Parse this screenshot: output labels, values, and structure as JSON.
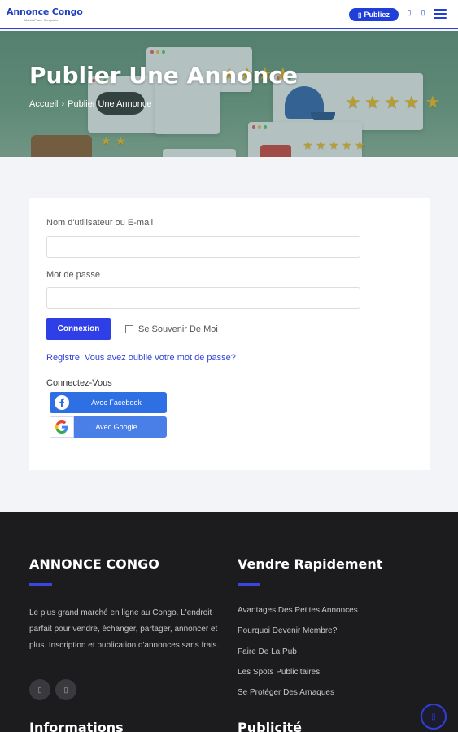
{
  "header": {
    "logo_title": "Annonce Congo",
    "logo_subtitle": "MarketPlace Congolais",
    "publish_label": "Publiez",
    "publish_icon": "▯"
  },
  "hero": {
    "title": "Publier Une Annonce",
    "breadcrumb_home": "Accueil",
    "breadcrumb_sep": "›",
    "breadcrumb_current": "Publier Une Annonce"
  },
  "login": {
    "username_label": "Nom d'utilisateur ou E-mail",
    "username_value": "",
    "password_label": "Mot de passe",
    "password_value": "",
    "submit_label": "Connexion",
    "remember_label": "Se Souvenir De Moi",
    "register_link": "Registre",
    "forgot_link": "Vous avez oublié votre mot de passe?",
    "connect_label": "Connectez-Vous",
    "facebook_label": "Avec Facebook",
    "google_label": "Avec Google"
  },
  "footer": {
    "about_heading": "ANNONCE CONGO",
    "about_text": "Le plus grand marché en ligne au Congo. L'endroit parfait pour vendre, échanger, partager, annoncer et plus. Inscription et publication d'annonces sans frais.",
    "sell_heading": "Vendre Rapidement",
    "sell_links": [
      "Avantages Des Petites Annonces",
      "Pourquoi Devenir Membre?",
      "Faire De La Pub",
      "Les Spots Publicitaires",
      "Se Protéger Des Arnaques"
    ],
    "info_heading": "Informations",
    "pub_heading": "Publicité"
  },
  "colors": {
    "accent": "#2f3fe8",
    "footer_bg": "#1c1c1e",
    "star": "#f3b51c"
  }
}
